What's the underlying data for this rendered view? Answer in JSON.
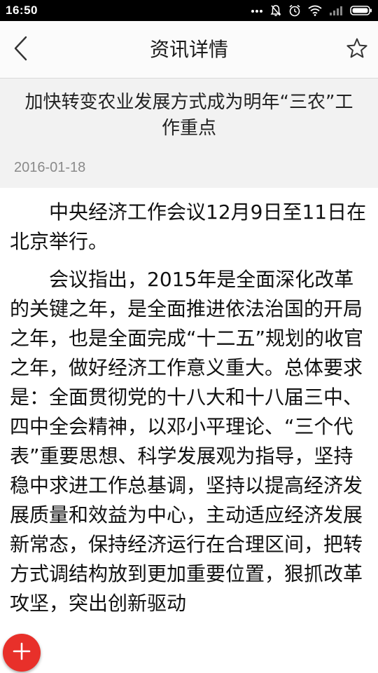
{
  "status_bar": {
    "time": "16:50",
    "icons": [
      "more-dots-icon",
      "mute-icon",
      "alarm-icon",
      "wifi-icon",
      "signal-icon",
      "battery-icon"
    ]
  },
  "nav": {
    "back_icon": "chevron-left-icon",
    "title": "资讯详情",
    "favorite_icon": "star-outline-icon"
  },
  "article": {
    "title": "加快转变农业发展方式成为明年“三农”工作重点",
    "date": "2016-01-18",
    "paragraphs": [
      "中央经济工作会议12月9日至11日在北京举行。",
      "会议指出，2015年是全面深化改革的关键之年，是全面推进依法治国的开局之年，也是全面完成“十二五”规划的收官之年，做好经济工作意义重大。总体要求是：全面贯彻党的十八大和十八届三中、四中全会精神，以邓小平理论、“三个代表”重要思想、科学发展观为指导，坚持稳中求进工作总基调，坚持以提高经济发展质量和效益为中心，主动适应经济发展新常态，保持经济运行在合理区间，把转方式调结构放到更加重要位置，狠抓改革攻坚，突出创新驱动"
    ]
  },
  "fab": {
    "icon": "plus-icon",
    "color": "#e8302a"
  }
}
